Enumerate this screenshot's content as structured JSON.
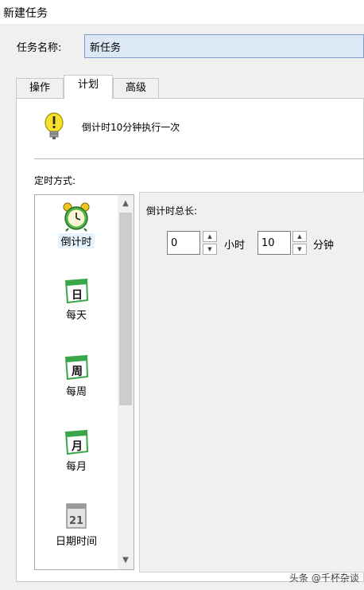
{
  "window": {
    "title": "新建任务"
  },
  "task": {
    "name_label": "任务名称:",
    "name_value": "新任务"
  },
  "tabs": [
    {
      "label": "操作",
      "active": false
    },
    {
      "label": "计划",
      "active": true
    },
    {
      "label": "高级",
      "active": false
    }
  ],
  "schedule": {
    "summary_icon": "lightbulb-icon",
    "summary": "倒计时10分钟执行一次",
    "mode_label": "定时方式:",
    "modes": [
      {
        "label": "倒计时",
        "icon": "alarm-clock-icon",
        "selected": true
      },
      {
        "label": "每天",
        "icon": "calendar-day-icon",
        "glyph": "日",
        "selected": false
      },
      {
        "label": "每周",
        "icon": "calendar-week-icon",
        "glyph": "周",
        "selected": false
      },
      {
        "label": "每月",
        "icon": "calendar-month-icon",
        "glyph": "月",
        "selected": false
      },
      {
        "label": "日期时间",
        "icon": "calendar-date-icon",
        "glyph": "21",
        "selected": false
      }
    ],
    "countdown": {
      "title": "倒计时总长:",
      "hours_value": "0",
      "hours_unit": "小时",
      "minutes_value": "10",
      "minutes_unit": "分钟"
    }
  },
  "watermark": "头条 @千杯杂谈",
  "colors": {
    "accent_input": "#dde8f5",
    "selection": "#e5f3ff",
    "calendar_green": "#3aa64a"
  }
}
